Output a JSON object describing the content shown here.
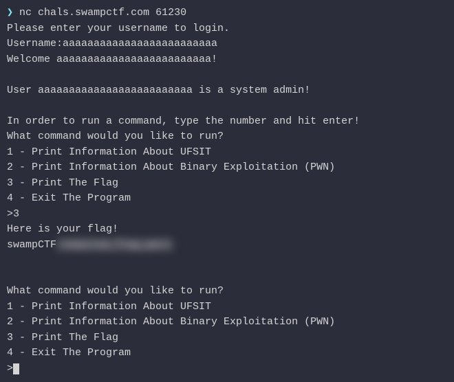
{
  "prompt": {
    "symbol": "❯",
    "command": "nc chals.swampctf.com 61230"
  },
  "session": {
    "login_prompt": "Please enter your username to login.",
    "username_line": "Username:aaaaaaaaaaaaaaaaaaaaaaaaa",
    "welcome": "Welcome aaaaaaaaaaaaaaaaaaaaaaaaa!",
    "admin_msg": "User aaaaaaaaaaaaaaaaaaaaaaaaa is a system admin!",
    "instructions": "In order to run a command, type the number and hit enter!",
    "menu_header": "What command would you like to run?",
    "menu": {
      "item1": "1 - Print Information About UFSIT",
      "item2": "2 - Print Information About Binary Exploitation (PWN)",
      "item3": "3 - Print The Flag",
      "item4": "4 - Exit The Program"
    },
    "input_prompt": ">",
    "user_input1": "3",
    "flag_intro": "Here is your flag!",
    "flag_prefix": "swampCTF",
    "flag_hidden": "redacted_flag_part"
  }
}
